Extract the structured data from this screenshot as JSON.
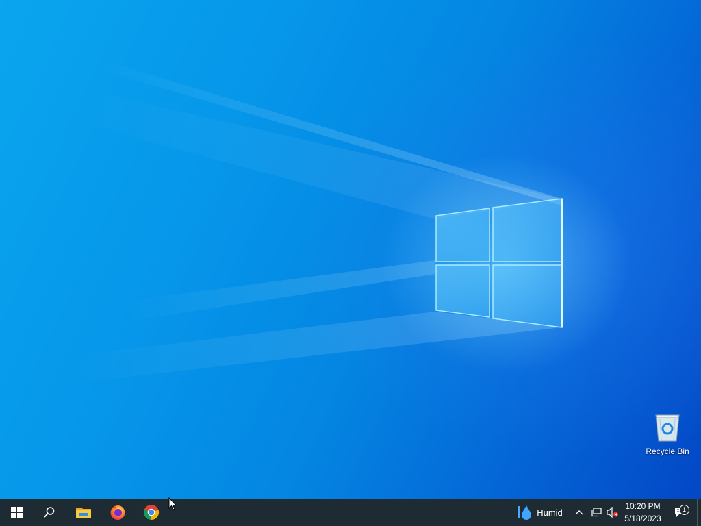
{
  "desktop": {
    "icons": [
      {
        "label": "Recycle Bin",
        "icon": "recycle-bin-icon"
      }
    ]
  },
  "taskbar": {
    "start": {
      "icon": "windows-logo-icon"
    },
    "search": {
      "icon": "search-icon"
    },
    "pinned": [
      {
        "app": "File Explorer",
        "icon": "file-explorer-icon"
      },
      {
        "app": "Firefox",
        "icon": "firefox-icon"
      },
      {
        "app": "Google Chrome",
        "icon": "chrome-icon"
      }
    ],
    "weather": {
      "label": "Humid",
      "icon": "water-drop-icon"
    },
    "tray_icons": [
      "chevron-up-icon",
      "network-icon",
      "volume-muted-icon"
    ],
    "clock": {
      "time": "10:20 PM",
      "date": "5/18/2023"
    },
    "notifications": {
      "count": "1",
      "icon": "action-center-icon"
    }
  },
  "colors": {
    "taskbar_bg": "#1f2b33",
    "wallpaper_light": "#0aa5ee",
    "wallpaper_dark": "#0347c6"
  }
}
